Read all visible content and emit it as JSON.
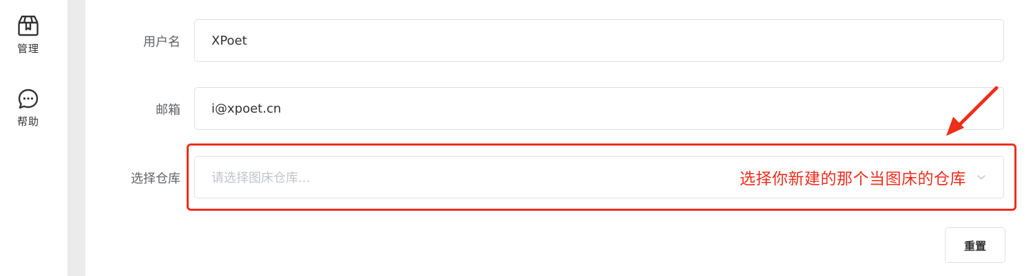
{
  "sidebar": {
    "items": [
      {
        "label": "管理",
        "icon": "package-icon"
      },
      {
        "label": "帮助",
        "icon": "chat-bubble-icon"
      }
    ]
  },
  "form": {
    "username": {
      "label": "用户名",
      "value": "XPoet"
    },
    "email": {
      "label": "邮箱",
      "value": "i@xpoet.cn"
    },
    "repo": {
      "label": "选择仓库",
      "placeholder": "请选择图床仓库..."
    },
    "reset_label": "重置"
  },
  "annotation": {
    "text": "选择你新建的那个当图床的仓库",
    "color": "#ee2d1b"
  }
}
